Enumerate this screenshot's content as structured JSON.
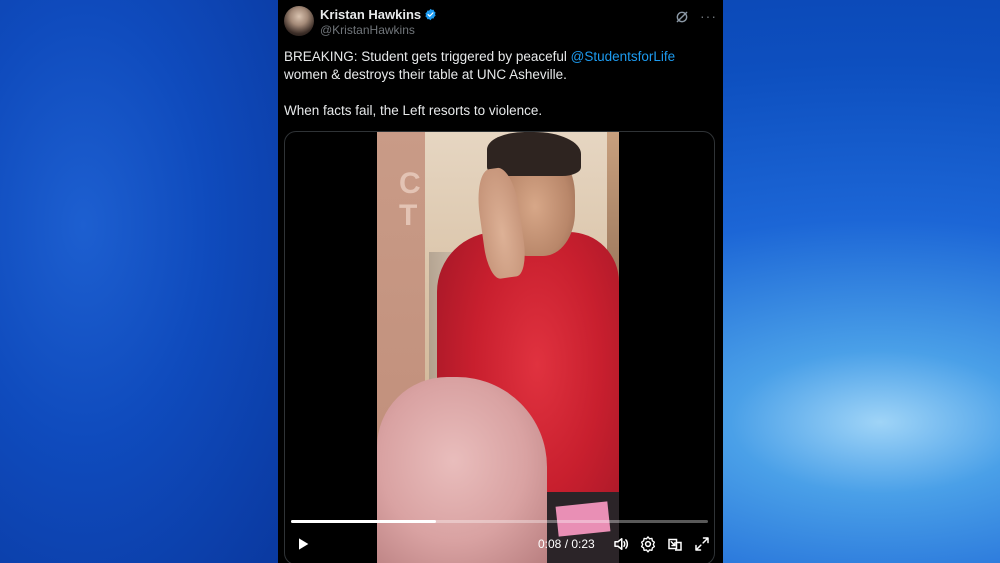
{
  "tweet": {
    "author_name": "Kristan Hawkins",
    "handle": "@KristanHawkins",
    "text_before_mention": "BREAKING: Student gets triggered by peaceful ",
    "mention": "@StudentsforLife",
    "text_after_mention": " women & destroys their table at UNC Asheville.",
    "text_line2": "When facts fail, the Left resorts to violence."
  },
  "video": {
    "time_display": "0:08 / 0:23",
    "progress": 0.3478,
    "background_text": "C\nT"
  },
  "colors": {
    "tweet_bg": "#000000",
    "mention": "#1d9bf0",
    "verified": "#1d9bf0",
    "secondary_text": "#71767b"
  },
  "icons": {
    "verified": "verified-badge-icon",
    "grok": "grok-icon",
    "more": "more-icon",
    "play": "play-icon",
    "volume": "volume-icon",
    "settings": "settings-icon",
    "pip": "picture-in-picture-icon",
    "fullscreen": "fullscreen-icon"
  }
}
